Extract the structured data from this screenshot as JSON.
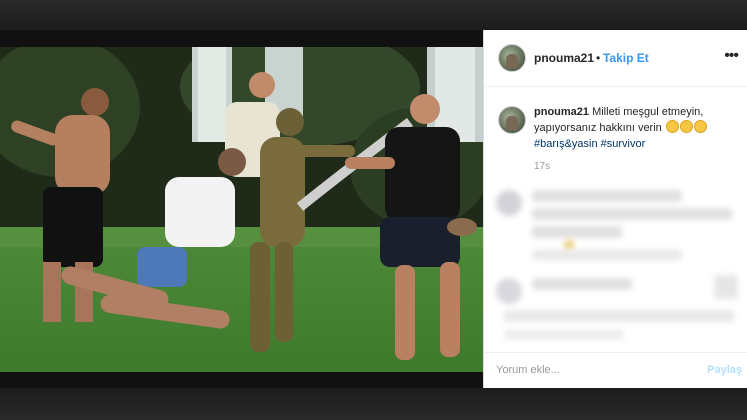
{
  "post": {
    "username": "pnouma21",
    "separator": "•",
    "follow_label": "Takip Et",
    "more_icon": "more-options-icon",
    "caption": {
      "username": "pnouma21",
      "text": "Milleti meşgul etmeyin, yapıyorsanız hakkını verin",
      "emoji": "laughing-emoji",
      "tags": [
        "#barış&yasin",
        "#survivor"
      ]
    },
    "timestamp": "17s"
  },
  "comment_box": {
    "placeholder": "Yorum ekle...",
    "post_label": "Paylaş"
  },
  "colors": {
    "link": "#3897f0",
    "hashtag": "#003569",
    "post_disabled": "#b2dffc"
  }
}
